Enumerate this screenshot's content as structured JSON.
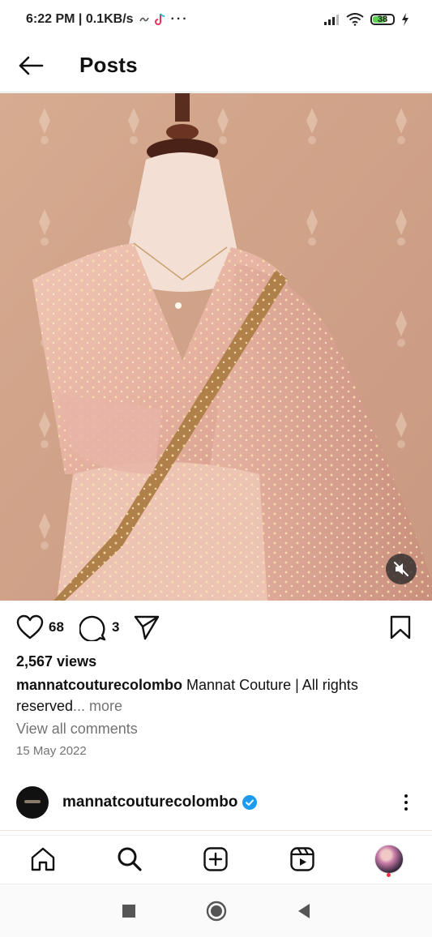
{
  "status_bar": {
    "time_speed": "6:22 PM | 0.1KB/s",
    "battery": "38",
    "colors": {
      "battery_fill": "#5ad150"
    }
  },
  "header": {
    "title": "Posts"
  },
  "post": {
    "likes": "68",
    "comments": "3",
    "views": "2,567 views",
    "caption_user": "mannatcouturecolombo",
    "caption_text": "Mannat Couture | All rights reserved",
    "caption_more": "... more",
    "view_comments": "View all comments",
    "date": "15 May 2022"
  },
  "next_post": {
    "username": "mannatcouturecolombo",
    "verified_color": "#1d9bf0"
  },
  "icons": {
    "header": "back-arrow-icon",
    "actions": [
      "heart-icon",
      "comment-icon",
      "share-icon",
      "bookmark-icon"
    ],
    "media": "muted-speaker-icon",
    "tabs": [
      "home-icon",
      "search-icon",
      "create-icon",
      "reels-icon",
      "profile-avatar"
    ],
    "system": [
      "recents-icon",
      "home-circle-icon",
      "back-triangle-icon"
    ]
  }
}
